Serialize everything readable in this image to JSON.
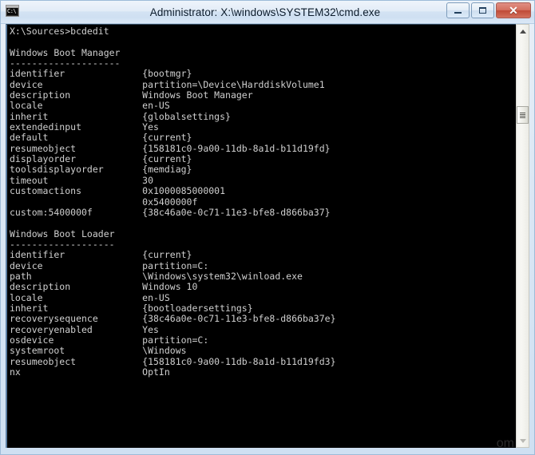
{
  "window": {
    "title": "Administrator: X:\\windows\\SYSTEM32\\cmd.exe",
    "icon_label": "C:\\",
    "icon_name": "cmd-prompt-icon",
    "buttons": {
      "minimize": "–",
      "maximize": "□",
      "close": "✕"
    },
    "colors": {
      "titlebar_top": "#eef4fb",
      "titlebar_bottom": "#dce9f7",
      "frame": "#9dbbd8",
      "close_button": "#bf4a37",
      "console_background": "#000000",
      "console_foreground": "#cfcfcf"
    }
  },
  "console": {
    "prompt_line": "X:\\Sources>bcdedit",
    "lines": [
      "X:\\Sources>bcdedit",
      "",
      "Windows Boot Manager",
      "--------------------",
      "identifier              {bootmgr}",
      "device                  partition=\\Device\\HarddiskVolume1",
      "description             Windows Boot Manager",
      "locale                  en-US",
      "inherit                 {globalsettings}",
      "extendedinput           Yes",
      "default                 {current}",
      "resumeobject            {158181c0-9a00-11db-8a1d-b11d19fd}",
      "displayorder            {current}",
      "toolsdisplayorder       {memdiag}",
      "timeout                 30",
      "customactions           0x1000085000001",
      "                        0x5400000f",
      "custom:5400000f         {38c46a0e-0c71-11e3-bfe8-d866ba37}",
      "",
      "Windows Boot Loader",
      "-------------------",
      "identifier              {current}",
      "device                  partition=C:",
      "path                    \\Windows\\system32\\winload.exe",
      "description             Windows 10",
      "locale                  en-US",
      "inherit                 {bootloadersettings}",
      "recoverysequence        {38c46a0e-0c71-11e3-bfe8-d866ba37e}",
      "recoveryenabled         Yes",
      "osdevice                partition=C:",
      "systemroot              \\Windows",
      "resumeobject            {158181c0-9a00-11db-8a1d-b11d19fd3}",
      "nx                      OptIn"
    ],
    "sections": [
      {
        "heading": "Windows Boot Manager",
        "underline": "--------------------",
        "entries": [
          {
            "key": "identifier",
            "value": "{bootmgr}"
          },
          {
            "key": "device",
            "value": "partition=\\Device\\HarddiskVolume1"
          },
          {
            "key": "description",
            "value": "Windows Boot Manager"
          },
          {
            "key": "locale",
            "value": "en-US"
          },
          {
            "key": "inherit",
            "value": "{globalsettings}"
          },
          {
            "key": "extendedinput",
            "value": "Yes"
          },
          {
            "key": "default",
            "value": "{current}"
          },
          {
            "key": "resumeobject",
            "value": "{158181c0-9a00-11db-8a1d-b11d19fd}"
          },
          {
            "key": "displayorder",
            "value": "{current}"
          },
          {
            "key": "toolsdisplayorder",
            "value": "{memdiag}"
          },
          {
            "key": "timeout",
            "value": "30"
          },
          {
            "key": "customactions",
            "value": "0x1000085000001"
          },
          {
            "key": "",
            "value": "0x5400000f"
          },
          {
            "key": "custom:5400000f",
            "value": "{38c46a0e-0c71-11e3-bfe8-d866ba37}"
          }
        ]
      },
      {
        "heading": "Windows Boot Loader",
        "underline": "-------------------",
        "entries": [
          {
            "key": "identifier",
            "value": "{current}"
          },
          {
            "key": "device",
            "value": "partition=C:"
          },
          {
            "key": "path",
            "value": "\\Windows\\system32\\winload.exe"
          },
          {
            "key": "description",
            "value": "Windows 10"
          },
          {
            "key": "locale",
            "value": "en-US"
          },
          {
            "key": "inherit",
            "value": "{bootloadersettings}"
          },
          {
            "key": "recoverysequence",
            "value": "{38c46a0e-0c71-11e3-bfe8-d866ba37e}"
          },
          {
            "key": "recoveryenabled",
            "value": "Yes"
          },
          {
            "key": "osdevice",
            "value": "partition=C:"
          },
          {
            "key": "systemroot",
            "value": "\\Windows"
          },
          {
            "key": "resumeobject",
            "value": "{158181c0-9a00-11db-8a1d-b11d19fd3}"
          },
          {
            "key": "nx",
            "value": "OptIn"
          }
        ]
      }
    ],
    "watermark": "om"
  },
  "scrollbar": {
    "up_arrow": "▲",
    "down_arrow": "▼"
  }
}
